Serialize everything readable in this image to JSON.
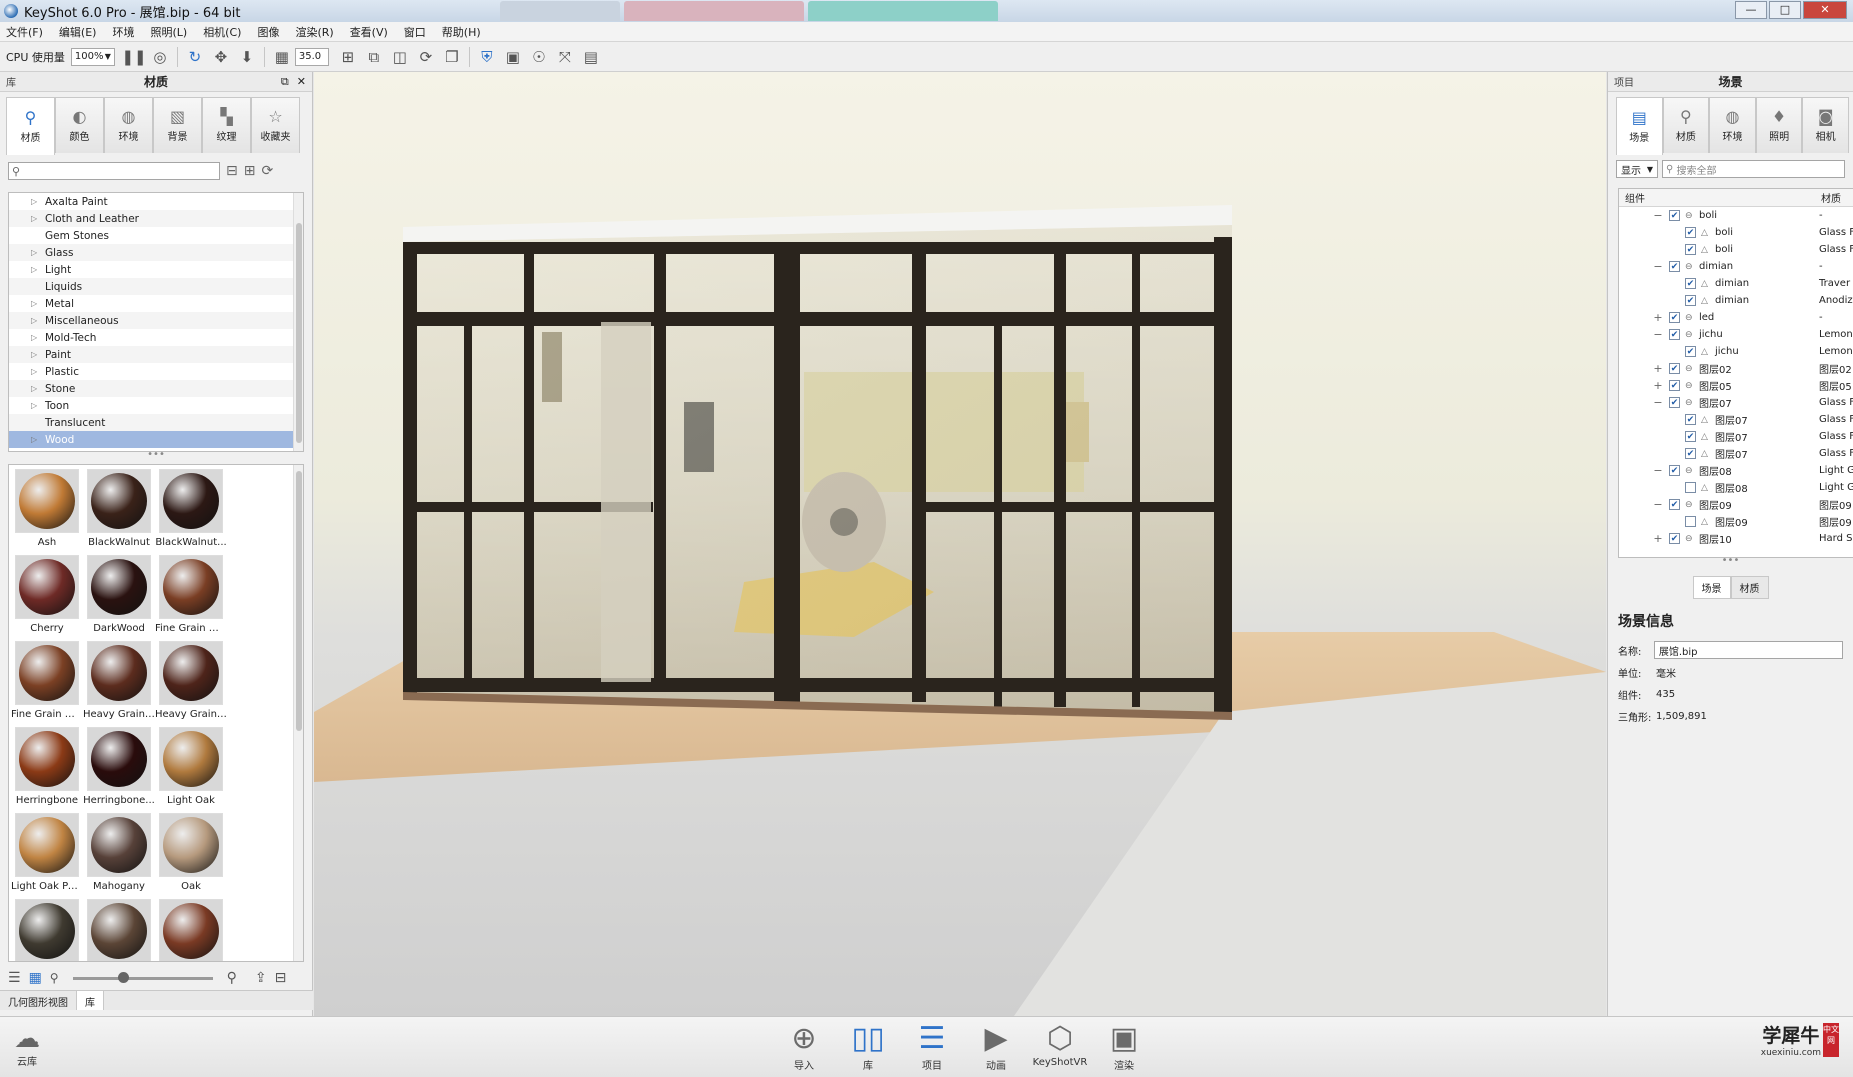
{
  "window": {
    "title": "KeyShot 6.0 Pro  - 展馆.bip  - 64 bit",
    "controls": {
      "minimize": "—",
      "maximize": "□",
      "close": "✕"
    }
  },
  "menu": [
    "文件(F)",
    "编辑(E)",
    "环境",
    "照明(L)",
    "相机(C)",
    "图像",
    "渲染(R)",
    "查看(V)",
    "窗口",
    "帮助(H)"
  ],
  "toolbar": {
    "cpu_label": "CPU 使用量",
    "cpu_value": "100%",
    "fov_value": "35.0"
  },
  "library": {
    "header": "库",
    "title": "材质",
    "tabs": [
      {
        "label": "材质",
        "icon": "material-icon"
      },
      {
        "label": "颜色",
        "icon": "color-icon"
      },
      {
        "label": "环境",
        "icon": "environment-icon"
      },
      {
        "label": "背景",
        "icon": "background-icon"
      },
      {
        "label": "纹理",
        "icon": "texture-icon"
      },
      {
        "label": "收藏夹",
        "icon": "favorites-icon"
      }
    ],
    "categories": [
      "Axalta Paint",
      "Cloth and Leather",
      "Gem Stones",
      "Glass",
      "Light",
      "Liquids",
      "Metal",
      "Miscellaneous",
      "Mold-Tech",
      "Paint",
      "Plastic",
      "Stone",
      "Toon",
      "Translucent",
      "Wood"
    ],
    "selected_category": "Wood",
    "materials": [
      {
        "name": "Ash",
        "color": "#c07a35"
      },
      {
        "name": "BlackWalnut",
        "color": "#3a2219"
      },
      {
        "name": "BlackWalnut...",
        "color": "#2c1814"
      },
      {
        "name": "Cherry",
        "color": "#6e2a26"
      },
      {
        "name": "DarkWood",
        "color": "#2a1210"
      },
      {
        "name": "Fine Grain W...",
        "color": "#7a3e24"
      },
      {
        "name": "Fine Grain W...",
        "color": "#7b4024"
      },
      {
        "name": "Heavy Grain ...",
        "color": "#5c2c1e"
      },
      {
        "name": "Heavy Grain ...",
        "color": "#4e241a"
      },
      {
        "name": "Herringbone",
        "color": "#8b3a16"
      },
      {
        "name": "Herringbone...",
        "color": "#2a0c0c"
      },
      {
        "name": "Light Oak",
        "color": "#b07a3e"
      },
      {
        "name": "Light Oak Pol...",
        "color": "#c08443"
      },
      {
        "name": "Mahogany",
        "color": "#574139"
      },
      {
        "name": "Oak",
        "color": "#b69a7e"
      },
      {
        "name": "",
        "color": "#3f3a30"
      },
      {
        "name": "",
        "color": "#5b4536"
      },
      {
        "name": "",
        "color": "#7a3a24"
      }
    ],
    "bottom_tabs": [
      "几何图形视图",
      "库"
    ]
  },
  "project": {
    "header": "项目",
    "title": "场景",
    "tabs": [
      {
        "label": "场景",
        "icon": "scene-icon"
      },
      {
        "label": "材质",
        "icon": "material-icon"
      },
      {
        "label": "环境",
        "icon": "environment-icon"
      },
      {
        "label": "照明",
        "icon": "lighting-icon"
      },
      {
        "label": "相机",
        "icon": "camera-icon"
      }
    ],
    "filter": "显示",
    "search_placeholder": "搜索全部",
    "columns": [
      "组件",
      "材质"
    ],
    "tree": [
      {
        "tog": "−",
        "lvl": 0,
        "chk": true,
        "name": "boli",
        "mat": "-"
      },
      {
        "tog": "",
        "lvl": 1,
        "chk": true,
        "name": "boli",
        "mat": "Glass F"
      },
      {
        "tog": "",
        "lvl": 1,
        "chk": true,
        "name": "boli",
        "mat": "Glass F"
      },
      {
        "tog": "−",
        "lvl": 0,
        "chk": true,
        "name": "dimian",
        "mat": "-"
      },
      {
        "tog": "",
        "lvl": 1,
        "chk": true,
        "name": "dimian",
        "mat": "Traver"
      },
      {
        "tog": "",
        "lvl": 1,
        "chk": true,
        "name": "dimian",
        "mat": "Anodiz"
      },
      {
        "tog": "+",
        "lvl": 0,
        "chk": true,
        "name": "led",
        "mat": "-"
      },
      {
        "tog": "−",
        "lvl": 0,
        "chk": true,
        "name": "jichu",
        "mat": "Lemon"
      },
      {
        "tog": "",
        "lvl": 1,
        "chk": true,
        "name": "jichu",
        "mat": "Lemon"
      },
      {
        "tog": "+",
        "lvl": 0,
        "chk": true,
        "name": "图层02",
        "mat": "图层02"
      },
      {
        "tog": "+",
        "lvl": 0,
        "chk": true,
        "name": "图层05",
        "mat": "图层05"
      },
      {
        "tog": "−",
        "lvl": 0,
        "chk": true,
        "name": "图层07",
        "mat": "Glass F"
      },
      {
        "tog": "",
        "lvl": 1,
        "chk": true,
        "name": "图层07",
        "mat": "Glass F"
      },
      {
        "tog": "",
        "lvl": 1,
        "chk": true,
        "name": "图层07",
        "mat": "Glass F"
      },
      {
        "tog": "",
        "lvl": 1,
        "chk": true,
        "name": "图层07",
        "mat": "Glass F"
      },
      {
        "tog": "−",
        "lvl": 0,
        "chk": true,
        "name": "图层08",
        "mat": "Light G"
      },
      {
        "tog": "",
        "lvl": 1,
        "chk": false,
        "name": "图层08",
        "mat": "Light G"
      },
      {
        "tog": "−",
        "lvl": 0,
        "chk": true,
        "name": "图层09",
        "mat": "图层09"
      },
      {
        "tog": "",
        "lvl": 1,
        "chk": false,
        "name": "图层09",
        "mat": "图层09"
      },
      {
        "tog": "+",
        "lvl": 0,
        "chk": true,
        "name": "图层10",
        "mat": "Hard S"
      }
    ],
    "bottom_tabs": [
      "场景",
      "材质"
    ],
    "info": {
      "title": "场景信息",
      "name_label": "名称:",
      "name_value": "展馆.bip",
      "unit_label": "单位:",
      "unit_value": "毫米",
      "parts_label": "组件:",
      "parts_value": "435",
      "tri_label": "三角形:",
      "tri_value": "1,509,891"
    }
  },
  "dock": {
    "cloud_label": "云库",
    "buttons": [
      "导入",
      "库",
      "项目",
      "动画",
      "KeyShotVR",
      "渲染"
    ]
  },
  "watermark": {
    "main": "学犀牛",
    "sub": "xuexiniu.com",
    "tag": "中文网"
  }
}
